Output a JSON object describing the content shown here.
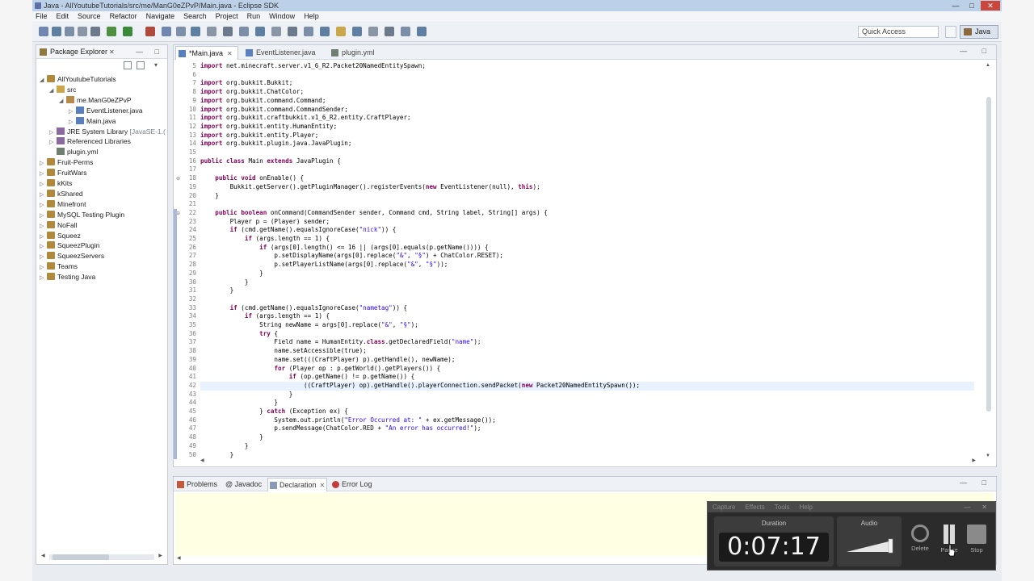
{
  "window": {
    "title": "Java - AllYoutubeTutorials/src/me/ManG0eZPvP/Main.java - Eclipse SDK",
    "min": "—",
    "max": "□",
    "close": "✕"
  },
  "menu": [
    "File",
    "Edit",
    "Source",
    "Refactor",
    "Navigate",
    "Search",
    "Project",
    "Run",
    "Window",
    "Help"
  ],
  "quick_access": "Quick Access",
  "perspective": "Java",
  "package_explorer": {
    "title": "Package Explorer",
    "close": "✕",
    "view_menu": "— □",
    "tree": [
      {
        "label": "AllYoutubeTutorials",
        "arrow": "◢",
        "icon": "project-icon",
        "extra": ""
      },
      {
        "label": "src",
        "arrow": "◢",
        "icon": "source-folder-icon",
        "extra": ""
      },
      {
        "label": "me.ManG0eZPvP",
        "arrow": "◢",
        "icon": "package-icon",
        "extra": ""
      },
      {
        "label": "EventListener.java",
        "arrow": "▷",
        "icon": "java-file-icon",
        "extra": ""
      },
      {
        "label": "Main.java",
        "arrow": "▷",
        "icon": "java-file-icon",
        "extra": ""
      },
      {
        "label": "JRE System Library",
        "arrow": "▷",
        "icon": "library-icon",
        "extra": "[JavaSE-1.("
      },
      {
        "label": "Referenced Libraries",
        "arrow": "▷",
        "icon": "library-icon",
        "extra": ""
      },
      {
        "label": "plugin.yml",
        "arrow": "",
        "icon": "yml-file-icon",
        "extra": ""
      },
      {
        "label": "Fruit-Perms",
        "arrow": "▷",
        "icon": "project-icon",
        "extra": ""
      },
      {
        "label": "FruitWars",
        "arrow": "▷",
        "icon": "project-icon",
        "extra": ""
      },
      {
        "label": "kKits",
        "arrow": "▷",
        "icon": "project-icon",
        "extra": ""
      },
      {
        "label": "kShared",
        "arrow": "▷",
        "icon": "project-icon",
        "extra": ""
      },
      {
        "label": "Minefront",
        "arrow": "▷",
        "icon": "project-icon",
        "extra": ""
      },
      {
        "label": "MySQL Testing Plugin",
        "arrow": "▷",
        "icon": "project-icon",
        "extra": ""
      },
      {
        "label": "NoFall",
        "arrow": "▷",
        "icon": "project-icon",
        "extra": ""
      },
      {
        "label": "Squeez",
        "arrow": "▷",
        "icon": "project-icon",
        "extra": ""
      },
      {
        "label": "SqueezPlugin",
        "arrow": "▷",
        "icon": "project-icon",
        "extra": ""
      },
      {
        "label": "SqueezServers",
        "arrow": "▷",
        "icon": "project-icon",
        "extra": ""
      },
      {
        "label": "Teams",
        "arrow": "▷",
        "icon": "project-icon",
        "extra": ""
      },
      {
        "label": "Testing Java",
        "arrow": "▷",
        "icon": "project-icon",
        "extra": ""
      }
    ]
  },
  "editor": {
    "tabs": [
      {
        "label": "*Main.java",
        "close": "✕",
        "active": true
      },
      {
        "label": "EventListener.java",
        "close": "",
        "active": false
      },
      {
        "label": "plugin.yml",
        "close": "",
        "active": false
      }
    ],
    "view_menu": "— □",
    "lines": [
      {
        "n": "5",
        "code": "import net.minecraft.server.v1_6_R2.Packet20NamedEntitySpawn;"
      },
      {
        "n": "6",
        "code": ""
      },
      {
        "n": "7",
        "code": "import org.bukkit.Bukkit;"
      },
      {
        "n": "8",
        "code": "import org.bukkit.ChatColor;"
      },
      {
        "n": "9",
        "code": "import org.bukkit.command.Command;"
      },
      {
        "n": "10",
        "code": "import org.bukkit.command.CommandSender;"
      },
      {
        "n": "11",
        "code": "import org.bukkit.craftbukkit.v1_6_R2.entity.CraftPlayer;"
      },
      {
        "n": "12",
        "code": "import org.bukkit.entity.HumanEntity;"
      },
      {
        "n": "13",
        "code": "import org.bukkit.entity.Player;"
      },
      {
        "n": "14",
        "code": "import org.bukkit.plugin.java.JavaPlugin;"
      },
      {
        "n": "15",
        "code": ""
      },
      {
        "n": "16",
        "code": "public class Main extends JavaPlugin {"
      },
      {
        "n": "17",
        "code": ""
      },
      {
        "n": "18",
        "code": "    public void onEnable() {"
      },
      {
        "n": "19",
        "code": "        Bukkit.getServer().getPluginManager().registerEvents(new EventListener(null), this);"
      },
      {
        "n": "20",
        "code": "    }"
      },
      {
        "n": "21",
        "code": ""
      },
      {
        "n": "22",
        "code": "    public boolean onCommand(CommandSender sender, Command cmd, String label, String[] args) {"
      },
      {
        "n": "23",
        "code": "        Player p = (Player) sender;"
      },
      {
        "n": "24",
        "code": "        if (cmd.getName().equalsIgnoreCase(\"nick\")) {"
      },
      {
        "n": "25",
        "code": "            if (args.length == 1) {"
      },
      {
        "n": "26",
        "code": "                if (args[0].length() <= 16 || (args[0].equals(p.getName()))) {"
      },
      {
        "n": "27",
        "code": "                    p.setDisplayName(args[0].replace(\"&\", \"§\") + ChatColor.RESET);"
      },
      {
        "n": "28",
        "code": "                    p.setPlayerListName(args[0].replace(\"&\", \"§\"));"
      },
      {
        "n": "29",
        "code": "                }"
      },
      {
        "n": "30",
        "code": "            }"
      },
      {
        "n": "31",
        "code": "        }"
      },
      {
        "n": "32",
        "code": ""
      },
      {
        "n": "33",
        "code": "        if (cmd.getName().equalsIgnoreCase(\"nametag\")) {"
      },
      {
        "n": "34",
        "code": "            if (args.length == 1) {"
      },
      {
        "n": "35",
        "code": "                String newName = args[0].replace(\"&\", \"§\");"
      },
      {
        "n": "36",
        "code": "                try {"
      },
      {
        "n": "37",
        "code": "                    Field name = HumanEntity.class.getDeclaredField(\"name\");"
      },
      {
        "n": "38",
        "code": "                    name.setAccessible(true);"
      },
      {
        "n": "39",
        "code": "                    name.set(((CraftPlayer) p).getHandle(), newName);"
      },
      {
        "n": "40",
        "code": "                    for (Player op : p.getWorld().getPlayers()) {"
      },
      {
        "n": "41",
        "code": "                        if (op.getName() != p.getName()) {"
      },
      {
        "n": "42",
        "code": "                            ((CraftPlayer) op).getHandle().playerConnection.sendPacket(new Packet20NamedEntitySpawn());"
      },
      {
        "n": "43",
        "code": "                        }"
      },
      {
        "n": "44",
        "code": "                    }"
      },
      {
        "n": "45",
        "code": "                } catch (Exception ex) {"
      },
      {
        "n": "46",
        "code": "                    System.out.println(\"Error Occurred at: \" + ex.getMessage());"
      },
      {
        "n": "47",
        "code": "                    p.sendMessage(ChatColor.RED + \"An error has occurred!\");"
      },
      {
        "n": "48",
        "code": "                }"
      },
      {
        "n": "49",
        "code": "            }"
      },
      {
        "n": "50",
        "code": "        }"
      }
    ]
  },
  "bottom_panel": {
    "tabs": [
      {
        "label": "Problems",
        "close": "",
        "active": false
      },
      {
        "label": "@ Javadoc",
        "close": "",
        "active": false
      },
      {
        "label": "Declaration",
        "close": "✕",
        "active": true
      },
      {
        "label": "Error Log",
        "close": "",
        "active": false
      }
    ],
    "view_menu": "— □"
  },
  "recorder": {
    "menu": [
      "Capture",
      "Effects",
      "Tools",
      "Help"
    ],
    "menu_ctl": "— ✕",
    "duration_label": "Duration",
    "duration": "0:07:17",
    "audio_label": "Audio",
    "delete": "Delete",
    "pause": "Pause",
    "stop": "Stop"
  },
  "colors": {
    "keyword": "#7f0055",
    "string": "#2a00ff",
    "field": "#0000c0",
    "current_line": "#e8f2fe"
  }
}
